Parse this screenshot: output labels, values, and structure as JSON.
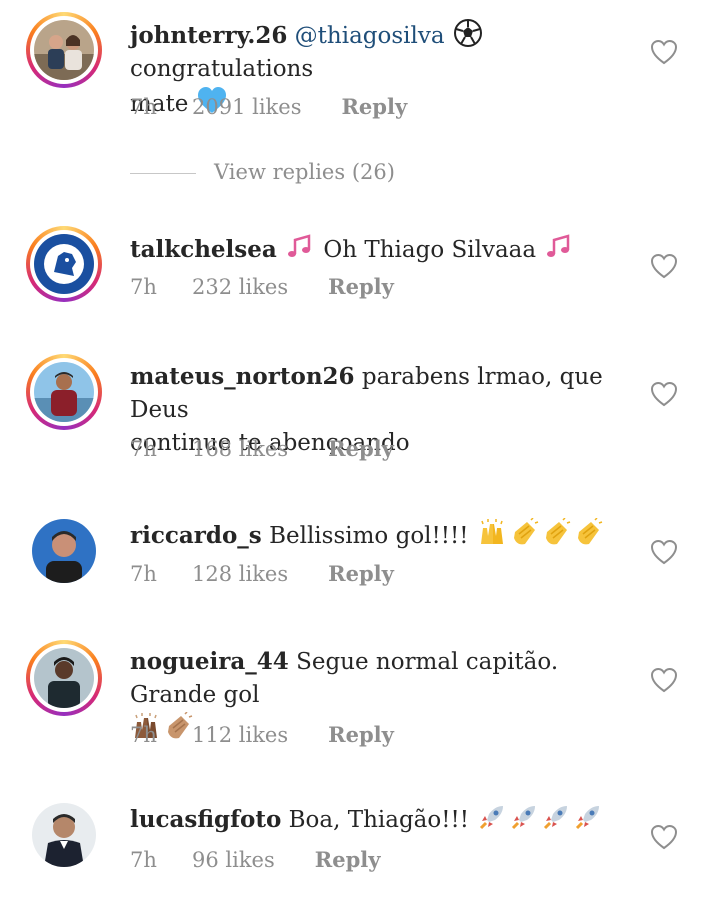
{
  "comments": [
    {
      "username": "johnterry.26",
      "mention": "@thiagosilva",
      "text_after_emoji": "congratulations",
      "text_line2": "mate",
      "time": "7h",
      "likes": "2091 likes",
      "reply": "Reply",
      "story_ring": true
    },
    {
      "username": "talkchelsea",
      "text": "Oh Thiago Silvaaa",
      "time": "7h",
      "likes": "232 likes",
      "reply": "Reply",
      "story_ring": true
    },
    {
      "username": "mateus_norton26",
      "text": "parabens lrmao, que Deus",
      "text_line2": "continue te abençoando",
      "time": "7h",
      "likes": "168 likes",
      "reply": "Reply",
      "story_ring": true
    },
    {
      "username": "riccardo_s",
      "text": "Bellissimo gol!!!!",
      "time": "7h",
      "likes": "128 likes",
      "reply": "Reply",
      "story_ring": false
    },
    {
      "username": "nogueira_44",
      "text": "Segue normal capitão. Grande gol",
      "time": "7h",
      "likes": "112 likes",
      "reply": "Reply",
      "story_ring": true
    },
    {
      "username": "lucasfigfoto",
      "text": "Boa, Thiagão!!!",
      "time": "7h",
      "likes": "96 likes",
      "reply": "Reply",
      "story_ring": false
    }
  ],
  "view_replies": "View replies (26)",
  "colors": {
    "text": "#262626",
    "meta": "#8e8e8e",
    "mention": "#1f4e79",
    "heart_outline": "#8e8e8e"
  },
  "icons": {
    "like": "heart-outline-icon",
    "soccer": "soccer-ball-emoji",
    "heart": "blue-heart-emoji",
    "notes": "musical-notes-emoji",
    "raise": "raising-hands-emoji",
    "clap": "clapping-hands-emoji",
    "rocket": "rocket-emoji"
  }
}
